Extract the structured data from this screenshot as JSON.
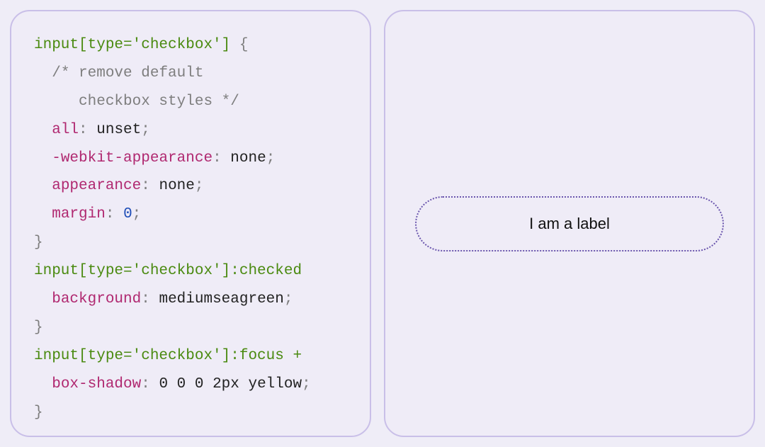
{
  "code": {
    "lines": [
      [
        {
          "t": "input[type='checkbox']",
          "c": "tok-selector"
        },
        {
          "t": " {",
          "c": "tok-punc"
        }
      ],
      [
        {
          "t": "  ",
          "c": ""
        },
        {
          "t": "/* remove default",
          "c": "tok-comment"
        }
      ],
      [
        {
          "t": "     checkbox styles */",
          "c": "tok-comment"
        }
      ],
      [
        {
          "t": "  ",
          "c": ""
        },
        {
          "t": "all",
          "c": "tok-prop"
        },
        {
          "t": ":",
          "c": "tok-punc"
        },
        {
          "t": " unset",
          "c": "tok-value"
        },
        {
          "t": ";",
          "c": "tok-punc"
        }
      ],
      [
        {
          "t": "  ",
          "c": ""
        },
        {
          "t": "-webkit-appearance",
          "c": "tok-prop"
        },
        {
          "t": ":",
          "c": "tok-punc"
        },
        {
          "t": " none",
          "c": "tok-value"
        },
        {
          "t": ";",
          "c": "tok-punc"
        }
      ],
      [
        {
          "t": "  ",
          "c": ""
        },
        {
          "t": "appearance",
          "c": "tok-prop"
        },
        {
          "t": ":",
          "c": "tok-punc"
        },
        {
          "t": " none",
          "c": "tok-value"
        },
        {
          "t": ";",
          "c": "tok-punc"
        }
      ],
      [
        {
          "t": "  ",
          "c": ""
        },
        {
          "t": "margin",
          "c": "tok-prop"
        },
        {
          "t": ":",
          "c": "tok-punc"
        },
        {
          "t": " ",
          "c": ""
        },
        {
          "t": "0",
          "c": "tok-num"
        },
        {
          "t": ";",
          "c": "tok-punc"
        }
      ],
      [
        {
          "t": "}",
          "c": "tok-punc"
        }
      ],
      [
        {
          "t": "input[type='checkbox']:checked",
          "c": "tok-selector"
        }
      ],
      [
        {
          "t": "  ",
          "c": ""
        },
        {
          "t": "background",
          "c": "tok-prop"
        },
        {
          "t": ":",
          "c": "tok-punc"
        },
        {
          "t": " mediumseagreen",
          "c": "tok-value"
        },
        {
          "t": ";",
          "c": "tok-punc"
        }
      ],
      [
        {
          "t": "}",
          "c": "tok-punc"
        }
      ],
      [
        {
          "t": "input[type='checkbox']:focus +",
          "c": "tok-selector"
        }
      ],
      [
        {
          "t": "  ",
          "c": ""
        },
        {
          "t": "box-shadow",
          "c": "tok-prop"
        },
        {
          "t": ":",
          "c": "tok-punc"
        },
        {
          "t": " 0 0 0 2px yellow",
          "c": "tok-value"
        },
        {
          "t": ";",
          "c": "tok-punc"
        }
      ],
      [
        {
          "t": "}",
          "c": "tok-punc"
        }
      ]
    ]
  },
  "preview": {
    "label_text": "I am a label"
  }
}
